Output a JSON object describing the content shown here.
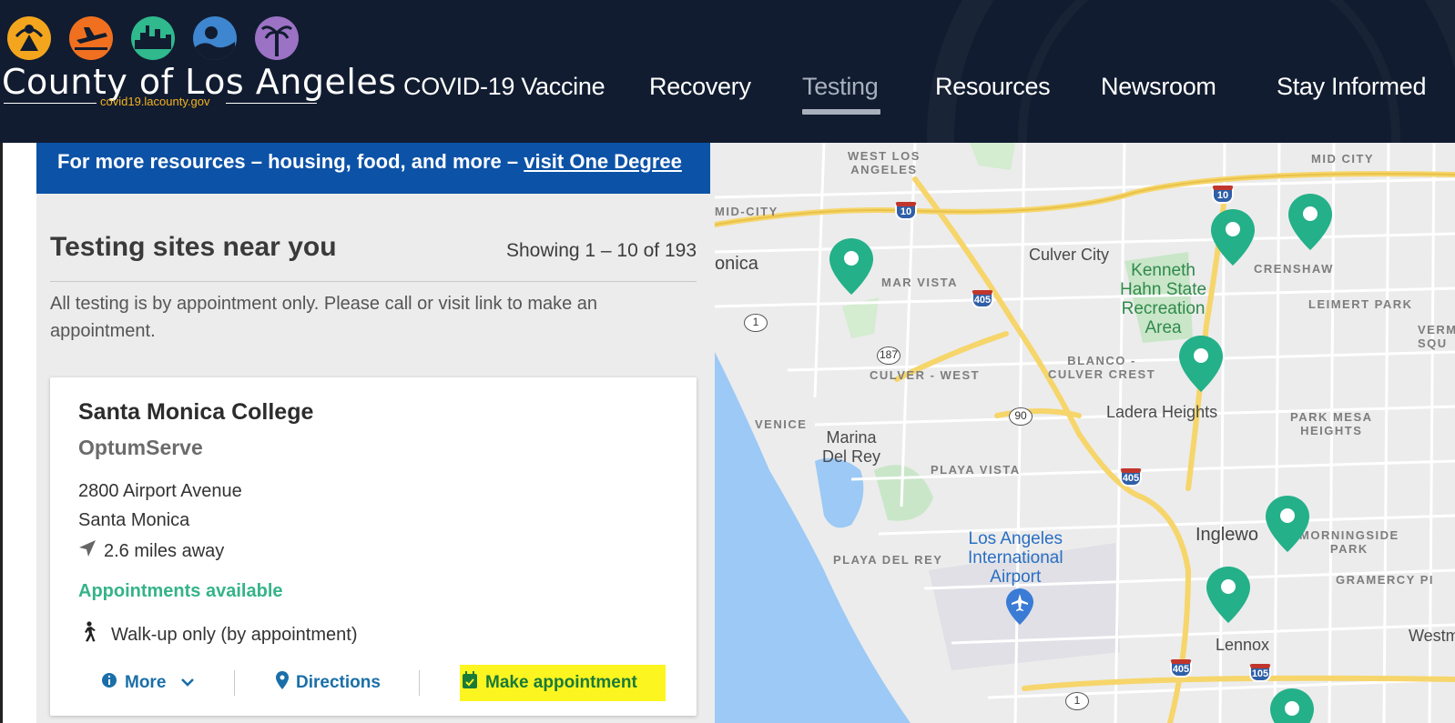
{
  "header": {
    "logo_title": "County of Los Angeles",
    "logo_url": "covid19.lacounty.gov",
    "logo_icon_colors": [
      "#f3a51d",
      "#f0701f",
      "#2fb98c",
      "#3e86cf",
      "#9b72c4"
    ],
    "nav": [
      {
        "label": "COVID-19 Vaccine",
        "active": false
      },
      {
        "label": "Recovery",
        "active": false
      },
      {
        "label": "Testing",
        "active": true
      },
      {
        "label": "Resources",
        "active": false
      },
      {
        "label": "Newsroom",
        "active": false
      },
      {
        "label": "Stay Informed",
        "active": false
      }
    ]
  },
  "banner": {
    "text": "For more resources – housing, food, and more – ",
    "link": "visit One Degree"
  },
  "sites": {
    "title": "Testing sites near you",
    "count": "Showing 1 – 10 of 193",
    "note": "All testing is by appointment only. Please call or visit link to make an appointment."
  },
  "card": {
    "name": "Santa Monica College",
    "provider": "OptumServe",
    "address_line1": "2800 Airport Avenue",
    "address_line2": "Santa Monica",
    "distance": "2.6 miles away",
    "availability": "Appointments available",
    "walkup": "Walk-up only (by appointment)",
    "actions": {
      "more": "More",
      "directions": "Directions",
      "appointment": "Make appointment"
    }
  },
  "map": {
    "labels": {
      "west_la": "WEST LOS\nANGELES",
      "mid_city_left": "MID-CITY",
      "santa_monica": "onica",
      "mar_vista": "MAR VISTA",
      "culver_city": "Culver City",
      "kenneth_hahn": "Kenneth\nHahn State\nRecreation\nArea",
      "crenshaw": "CRENSHAW",
      "leimert_park": "LEIMERT PARK",
      "mid_city_right": "MID CITY",
      "culver_west": "CULVER - WEST",
      "blanco": "BLANCO -\nCULVER CREST",
      "ladera_heights": "Ladera Heights",
      "park_mesa": "PARK MESA\nHEIGHTS",
      "venice": "VENICE",
      "marina": "Marina\nDel Rey",
      "playa_vista": "PLAYA VISTA",
      "lax": "Los Angeles\nInternational\nAirport",
      "playa_del_rey": "PLAYA DEL REY",
      "inglewood": "Inglewo",
      "morningside": "MORNINGSIDE\nPARK",
      "gramercy": "GRAMERCY PI",
      "lennox": "Lennox",
      "westmont": "Westmo",
      "verm": "VERM\nSQU"
    },
    "shields": [
      "10",
      "10",
      "405",
      "405",
      "405",
      "105"
    ],
    "routes": [
      "1",
      "187",
      "90",
      "1"
    ],
    "pin_color": "#24b089"
  }
}
